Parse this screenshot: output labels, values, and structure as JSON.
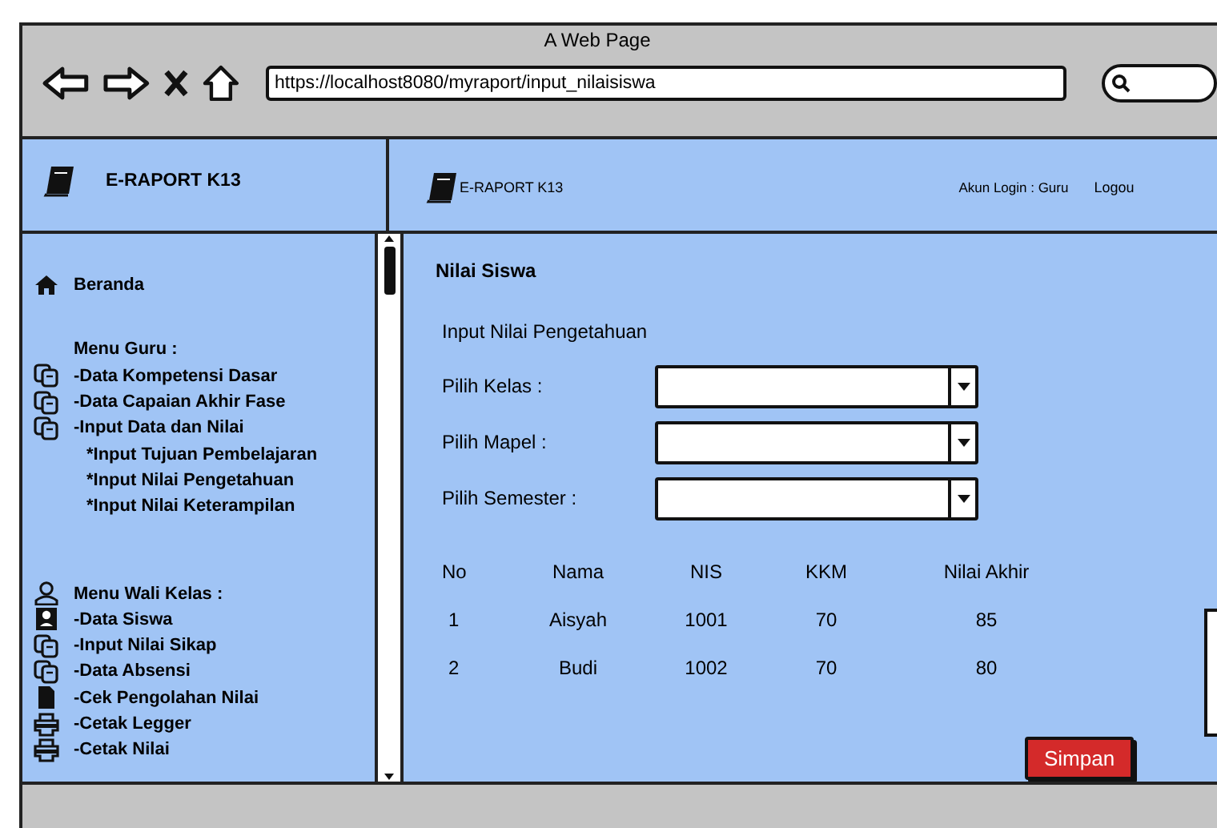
{
  "window": {
    "title": "A Web Page",
    "url": "https://localhost8080/myraport/input_nilaisiswa"
  },
  "header": {
    "brand": "E-RAPORT K13",
    "app_title": "E-RAPORT K13",
    "account": "Akun Login : Guru",
    "logout": "Logou"
  },
  "sidebar": {
    "sections": [
      {
        "items": [
          {
            "kind": "link",
            "label": "Beranda"
          }
        ]
      },
      {
        "items": [
          {
            "kind": "heading",
            "label": "Menu Guru :"
          },
          {
            "kind": "link",
            "label": "-Data Kompetensi Dasar"
          },
          {
            "kind": "link",
            "label": "-Data Capaian Akhir Fase"
          },
          {
            "kind": "link",
            "label": "-Input Data dan Nilai"
          },
          {
            "kind": "subitem",
            "label": "*Input Tujuan Pembelajaran"
          },
          {
            "kind": "subitem",
            "label": "*Input Nilai Pengetahuan"
          },
          {
            "kind": "subitem",
            "label": "*Input Nilai Keterampilan"
          }
        ]
      },
      {
        "items": [
          {
            "kind": "heading",
            "label": "Menu Wali Kelas :"
          },
          {
            "kind": "link",
            "label": "-Data Siswa"
          },
          {
            "kind": "link",
            "label": "-Input Nilai Sikap"
          },
          {
            "kind": "link",
            "label": "-Data Absensi"
          },
          {
            "kind": "link",
            "label": "-Cek Pengolahan Nilai"
          },
          {
            "kind": "link",
            "label": "-Cetak Legger"
          },
          {
            "kind": "link",
            "label": "-Cetak Nilai"
          }
        ]
      }
    ]
  },
  "main": {
    "title": "Nilai Siswa",
    "subtitle": "Input Nilai Pengetahuan",
    "fields": [
      {
        "label": "Pilih Kelas :"
      },
      {
        "label": "Pilih Mapel :"
      },
      {
        "label": "Pilih Semester :"
      }
    ],
    "table": {
      "columns": [
        "No",
        "Nama",
        "NIS",
        "KKM",
        "Nilai Akhir"
      ],
      "rows": [
        [
          "1",
          "Aisyah",
          "1001",
          "70",
          "85"
        ],
        [
          "2",
          "Budi",
          "1002",
          "70",
          "80"
        ]
      ]
    },
    "save_button": "Simpan"
  }
}
